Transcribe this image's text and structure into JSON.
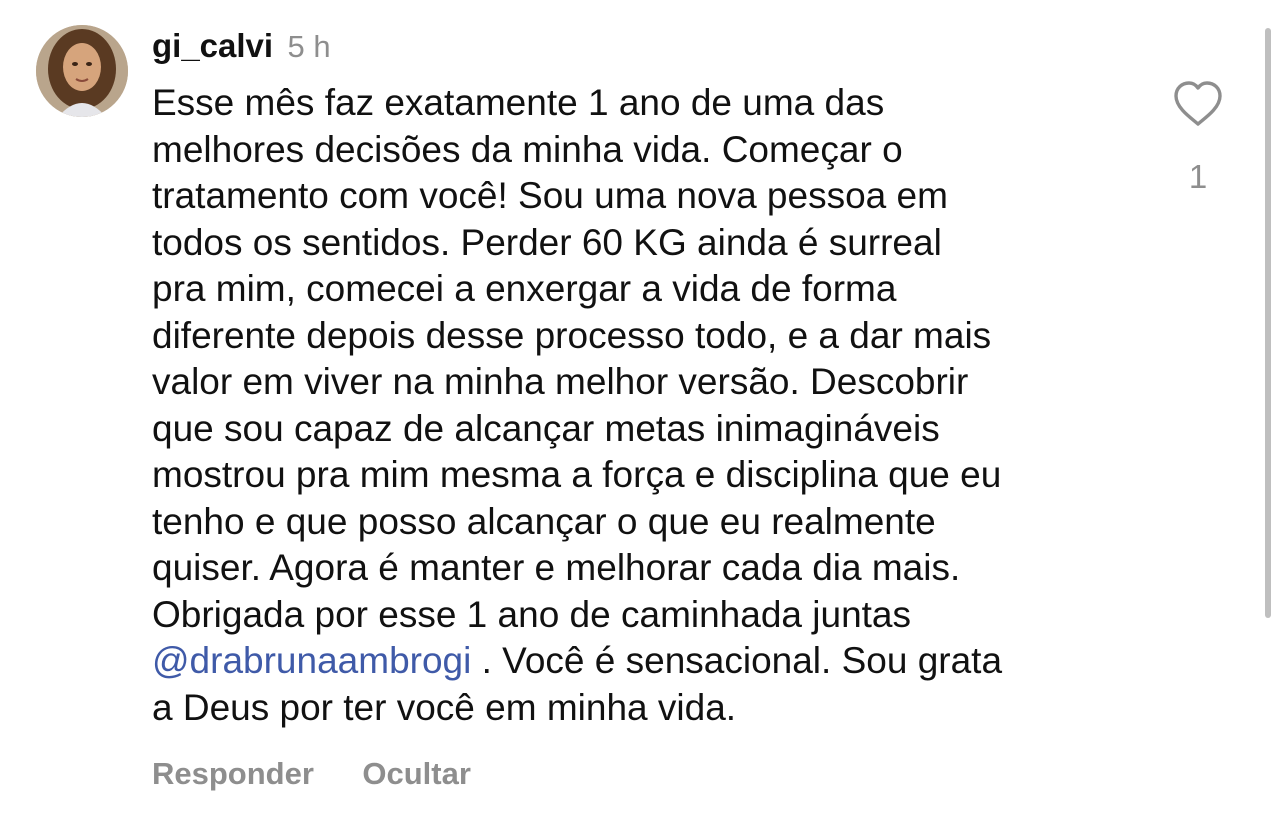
{
  "comment": {
    "username": "gi_calvi",
    "time": "5 h",
    "avatar_icon": "user-profile-photo",
    "lines": [
      "Esse mês faz exatamente 1 ano de uma das",
      "melhores decisões da minha vida. Começar o",
      "tratamento com você! Sou uma nova pessoa em",
      "todos os sentidos. Perder 60 KG ainda é surreal",
      "pra mim, comecei a enxergar a vida de forma",
      "diferente depois desse processo todo, e a dar mais",
      "valor em viver na minha melhor versão. Descobrir",
      "que sou capaz de alcançar metas inimagináveis",
      "mostrou pra mim mesma a força e disciplina que eu",
      "tenho e que posso alcançar o que eu realmente",
      "quiser. Agora é manter e melhorar cada dia mais.",
      "Obrigada por esse 1 ano de caminhada juntas"
    ],
    "mention": "@drabrunaambrogi",
    "after_mention": " . Você é sensacional. Sou grata",
    "last_line": "a Deus por ter você em minha vida.",
    "like_icon": "heart-outline-icon",
    "like_count": "1",
    "actions": {
      "reply": "Responder",
      "hide": "Ocultar"
    }
  },
  "colors": {
    "text": "#111111",
    "muted": "#8e8e8e",
    "mention": "#3f5aa8"
  }
}
